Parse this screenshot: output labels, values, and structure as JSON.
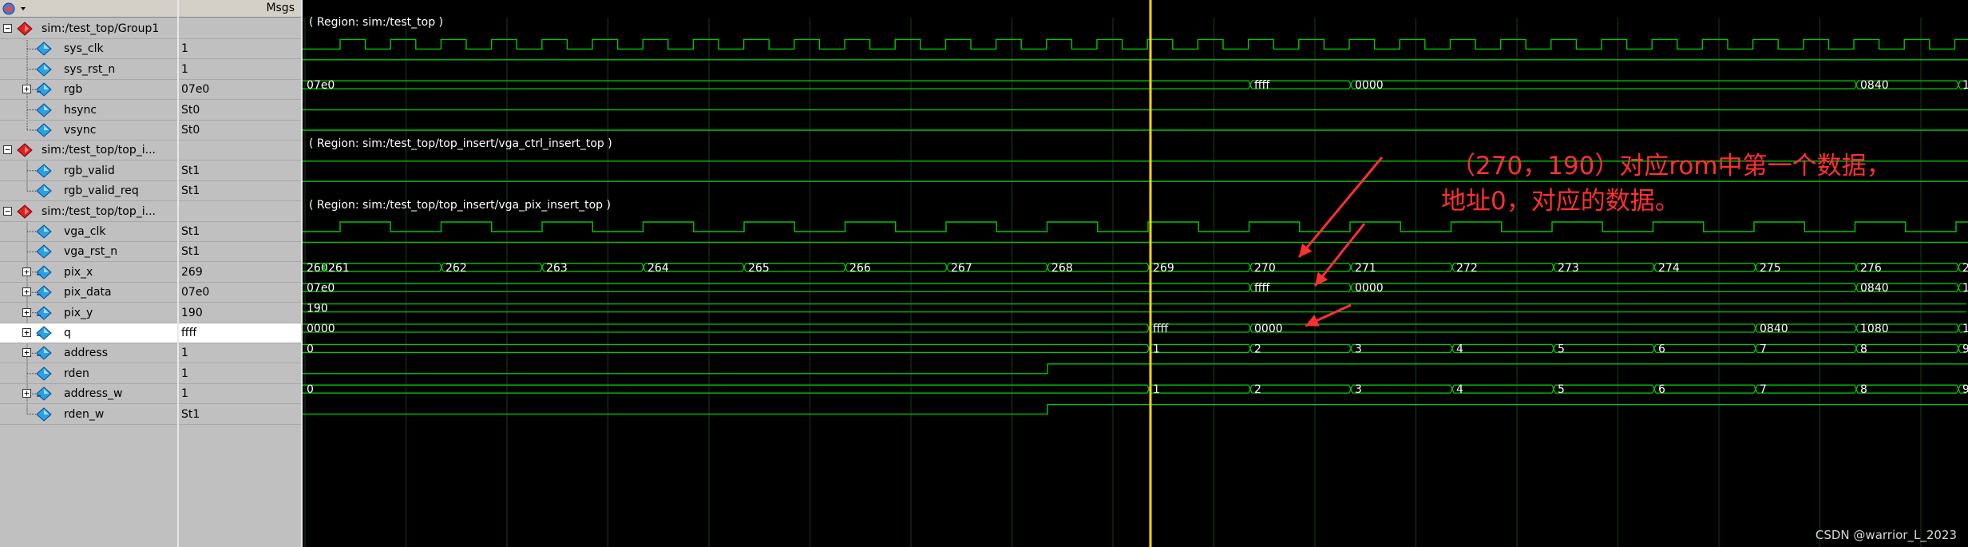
{
  "header": {
    "msgs_label": "Msgs"
  },
  "colors": {
    "wave": "#00c800",
    "cursor": "#ffd700",
    "annotation": "#ff3030",
    "grid": "#1e3a1e"
  },
  "signals": [
    {
      "name": "sim:/test_top/Group1",
      "value": "",
      "type": "group",
      "icon": "group-diamond-icon"
    },
    {
      "name": "sys_clk",
      "value": "1",
      "type": "bit",
      "icon": "signal-diamond-icon"
    },
    {
      "name": "sys_rst_n",
      "value": "1",
      "type": "bit",
      "icon": "signal-diamond-icon"
    },
    {
      "name": "rgb",
      "value": "07e0",
      "type": "bus",
      "icon": "bus-diamond-icon"
    },
    {
      "name": "hsync",
      "value": "St0",
      "type": "bit",
      "icon": "signal-diamond-icon"
    },
    {
      "name": "vsync",
      "value": "St0",
      "type": "bit",
      "icon": "signal-diamond-icon"
    },
    {
      "name": "sim:/test_top/top_i...",
      "value": "",
      "type": "group",
      "icon": "group-diamond-icon"
    },
    {
      "name": "rgb_valid",
      "value": "St1",
      "type": "bit",
      "icon": "signal-diamond-icon"
    },
    {
      "name": "rgb_valid_req",
      "value": "St1",
      "type": "bit",
      "icon": "signal-diamond-icon"
    },
    {
      "name": "sim:/test_top/top_i...",
      "value": "",
      "type": "group",
      "icon": "group-diamond-icon"
    },
    {
      "name": "vga_clk",
      "value": "St1",
      "type": "bit",
      "icon": "signal-diamond-icon"
    },
    {
      "name": "vga_rst_n",
      "value": "St1",
      "type": "bit",
      "icon": "signal-diamond-icon"
    },
    {
      "name": "pix_x",
      "value": "269",
      "type": "bus",
      "icon": "bus-diamond-icon"
    },
    {
      "name": "pix_data",
      "value": "07e0",
      "type": "bus",
      "icon": "bus-diamond-icon"
    },
    {
      "name": "pix_y",
      "value": "190",
      "type": "bus",
      "icon": "bus-diamond-icon"
    },
    {
      "name": "q",
      "value": "ffff",
      "type": "bus",
      "icon": "bus-diamond-icon",
      "selected": true
    },
    {
      "name": "address",
      "value": "1",
      "type": "bus",
      "icon": "bus-diamond-icon"
    },
    {
      "name": "rden",
      "value": "1",
      "type": "bit",
      "icon": "signal-diamond-icon"
    },
    {
      "name": "address_w",
      "value": "1",
      "type": "bus",
      "icon": "bus-diamond-icon"
    },
    {
      "name": "rden_w",
      "value": "St1",
      "type": "bit",
      "icon": "signal-diamond-icon"
    }
  ],
  "regions": [
    {
      "row": 0,
      "text": "( Region: sim:/test_top )"
    },
    {
      "row": 6,
      "text": "( Region: sim:/test_top/top_insert/vga_ctrl_insert_top )"
    },
    {
      "row": 9,
      "text": "( Region: sim:/test_top/top_insert/vga_pix_insert_top )"
    }
  ],
  "bus_values": {
    "rgb": [
      {
        "label": "07e0"
      },
      {
        "label": "ffff"
      },
      {
        "label": "0000"
      },
      {
        "label": "0840"
      },
      {
        "label": "1"
      }
    ],
    "pix_x": [
      {
        "label": "260"
      },
      {
        "label": "261"
      },
      {
        "label": "262"
      },
      {
        "label": "263"
      },
      {
        "label": "264"
      },
      {
        "label": "265"
      },
      {
        "label": "266"
      },
      {
        "label": "267"
      },
      {
        "label": "268"
      },
      {
        "label": "269"
      },
      {
        "label": "270"
      },
      {
        "label": "271"
      },
      {
        "label": "272"
      },
      {
        "label": "273"
      },
      {
        "label": "274"
      },
      {
        "label": "275"
      },
      {
        "label": "276"
      },
      {
        "label": "2"
      }
    ],
    "pix_data": [
      {
        "label": "07e0"
      },
      {
        "label": "ffff"
      },
      {
        "label": "0000"
      },
      {
        "label": "0840"
      },
      {
        "label": "1"
      }
    ],
    "pix_y": [
      {
        "label": "190"
      }
    ],
    "q": [
      {
        "label": "0000"
      },
      {
        "label": "ffff"
      },
      {
        "label": "0000"
      },
      {
        "label": "0840"
      },
      {
        "label": "1080"
      },
      {
        "label": "1"
      }
    ],
    "address": [
      {
        "label": "0"
      },
      {
        "label": "1"
      },
      {
        "label": "2"
      },
      {
        "label": "3"
      },
      {
        "label": "4"
      },
      {
        "label": "5"
      },
      {
        "label": "6"
      },
      {
        "label": "7"
      },
      {
        "label": "8"
      },
      {
        "label": "9"
      }
    ],
    "address_w": [
      {
        "label": "0"
      },
      {
        "label": "1"
      },
      {
        "label": "2"
      },
      {
        "label": "3"
      },
      {
        "label": "4"
      },
      {
        "label": "5"
      },
      {
        "label": "6"
      },
      {
        "label": "7"
      },
      {
        "label": "8"
      },
      {
        "label": "9"
      }
    ]
  },
  "annotation": {
    "line1": "（270，190）对应rom中第一个数据，",
    "line2": "地址0，对应的数据。"
  },
  "watermark": "CSDN @warrior_L_2023"
}
